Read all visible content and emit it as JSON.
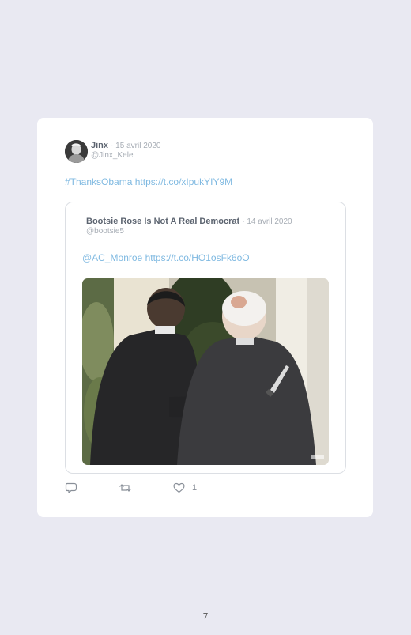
{
  "tweet": {
    "author_name": "Jinx",
    "date": "· 15 avril 2020",
    "handle": "@Jinx_Kele",
    "hashtag": "#ThanksObama",
    "link": "https://t.co/xIpukYIY9M"
  },
  "quoted_tweet": {
    "author_name": "Bootsie Rose Is Not A Real Democrat",
    "date": "· 14 avril 2020",
    "handle": "@bootsie5",
    "mention": "@AC_Monroe",
    "link": "https://t.co/HO1osFk6oO"
  },
  "actions": {
    "reply_icon": "reply-icon",
    "retweet_icon": "retweet-icon",
    "like_icon": "heart-icon",
    "like_count": "1"
  },
  "page": {
    "number": "7"
  },
  "colors": {
    "background": "#e9e9f2",
    "card": "#ffffff",
    "link": "#7fb9e1",
    "name": "#5c6470",
    "muted": "#a6acb4"
  }
}
